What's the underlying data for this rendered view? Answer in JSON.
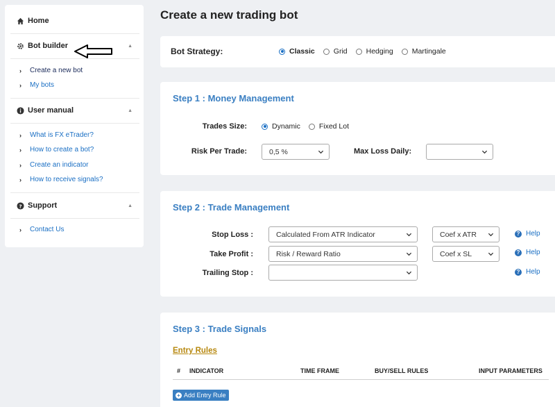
{
  "sidebar": {
    "home": "Home",
    "sections": [
      {
        "title": "Bot builder",
        "items": [
          "Create a new bot",
          "My bots"
        ]
      },
      {
        "title": "User manual",
        "items": [
          "What is FX eTrader?",
          "How to create a bot?",
          "Create an indicator",
          "How to receive signals?"
        ]
      },
      {
        "title": "Support",
        "items": [
          "Contact Us"
        ]
      }
    ]
  },
  "page": {
    "title": "Create a new trading bot"
  },
  "strategy": {
    "label": "Bot Strategy:",
    "options": [
      "Classic",
      "Grid",
      "Hedging",
      "Martingale"
    ],
    "selected": "Classic"
  },
  "step1": {
    "title": "Step 1 : Money Management",
    "trades_size_label": "Trades Size:",
    "trades_size_options": [
      "Dynamic",
      "Fixed Lot"
    ],
    "trades_size_selected": "Dynamic",
    "risk_label": "Risk Per Trade:",
    "risk_value": "0,5 %",
    "max_loss_label": "Max Loss Daily:",
    "max_loss_value": ""
  },
  "step2": {
    "title": "Step 2 : Trade Management",
    "rows": [
      {
        "label": "Stop Loss :",
        "method": "Calculated From ATR Indicator",
        "coef": "Coef x ATR",
        "help": "Help"
      },
      {
        "label": "Take Profit :",
        "method": "Risk / Reward Ratio",
        "coef": "Coef x SL",
        "help": "Help"
      },
      {
        "label": "Trailing Stop :",
        "method": "",
        "coef": null,
        "help": "Help"
      }
    ]
  },
  "step3": {
    "title": "Step 3 : Trade Signals",
    "entry_rules": "Entry Rules",
    "columns": [
      "#",
      "INDICATOR",
      "TIME FRAME",
      "BUY/SELL RULES",
      "INPUT PARAMETERS"
    ],
    "add_button": "Add Entry Rule"
  },
  "colors": {
    "accent": "#3a7fc2",
    "link": "#1a6fc4",
    "entry_rules": "#b7880f",
    "background": "#eef0f3"
  }
}
